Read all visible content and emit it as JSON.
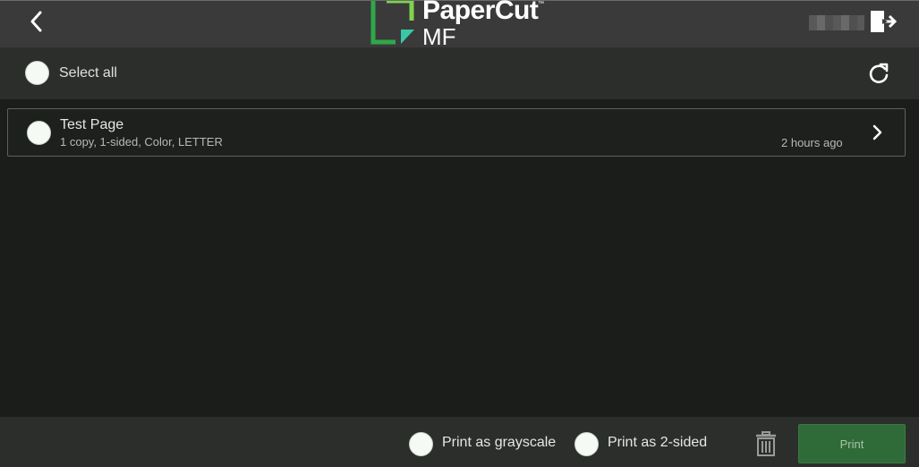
{
  "header": {
    "logo_primary": "PaperCut",
    "logo_tm": "™",
    "logo_secondary": "MF",
    "icons": [
      "chevron-left-icon",
      "logout-icon"
    ],
    "brand_colors": {
      "logo_green_dark": "#2fa84a",
      "logo_green_light": "#7fd34e",
      "logo_teal": "#38c8a8"
    }
  },
  "toolbar": {
    "select_all_label": "Select all",
    "refresh_icon": "refresh-icon"
  },
  "jobs": [
    {
      "title": "Test Page",
      "description": "1 copy, 1-sided, Color, LETTER",
      "time": "2 hours ago"
    }
  ],
  "footer": {
    "grayscale_label": "Print as grayscale",
    "two_sided_label": "Print as 2-sided",
    "delete_icon": "trash-icon",
    "print_label": "Print",
    "print_color": "#2f6b38"
  }
}
